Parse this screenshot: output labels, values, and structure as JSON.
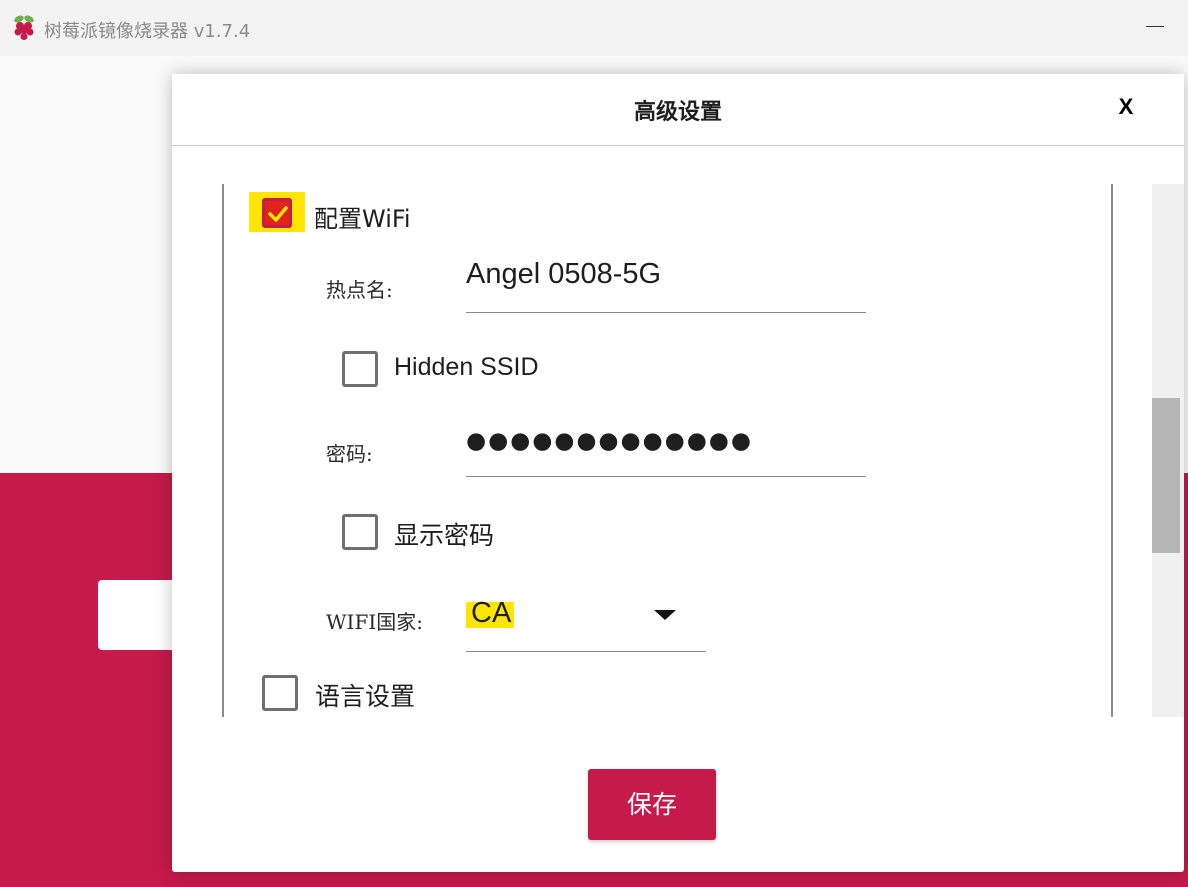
{
  "window": {
    "title": "树莓派镜像烧录器 v1.7.4",
    "app_icon": "raspberry-icon"
  },
  "colors": {
    "brand": "#c51a4a",
    "checkbox_checked": "#e0241a",
    "highlight": "#ffe600"
  },
  "dialog": {
    "title": "高级设置",
    "close_label": "X",
    "wifi": {
      "checkbox_label": "配置WiFi",
      "checked": true,
      "ssid_label": "热点名:",
      "ssid_value": "Angel 0508-5G",
      "hidden_ssid_label": "Hidden SSID",
      "hidden_ssid_checked": false,
      "password_label": "密码:",
      "password_mask": "●●●●●●●●●●●●●",
      "show_password_label": "显示密码",
      "show_password_checked": false,
      "country_label": "WIFI国家:",
      "country_value": "CA"
    },
    "locale": {
      "checkbox_label": "语言设置",
      "checked": false
    },
    "save_label": "保存"
  }
}
